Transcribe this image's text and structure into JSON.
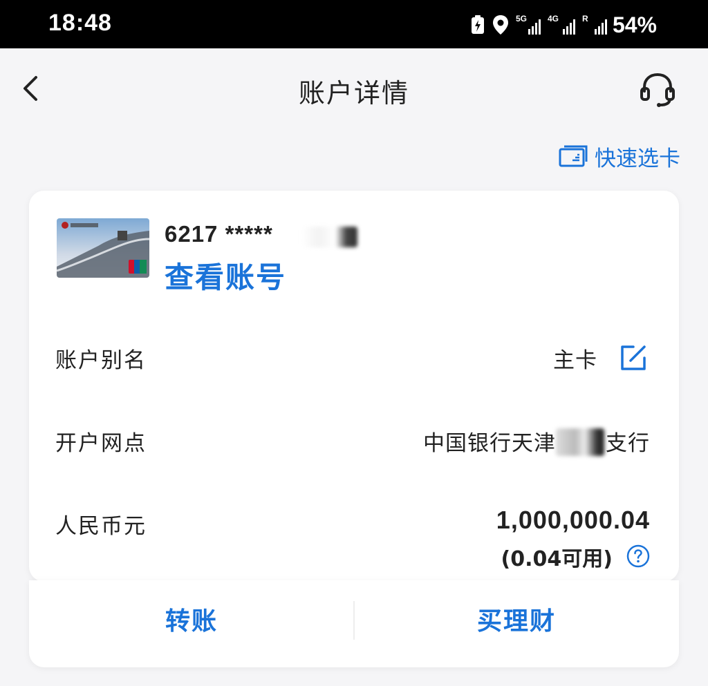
{
  "status_bar": {
    "time": "18:48",
    "network1": "5G",
    "network2": "4G",
    "roaming": "R",
    "battery_percent": "54%"
  },
  "header": {
    "title": "账户详情",
    "back_icon": "chevron-left-icon",
    "support_icon": "headset-icon"
  },
  "quick_select": {
    "label": "快速选卡",
    "icon": "card-stack-icon"
  },
  "card": {
    "number_masked": "6217 *****",
    "view_account_label": "查看账号",
    "thumbnail": "bank-card-image"
  },
  "details": {
    "alias_label": "账户别名",
    "alias_value": "主卡",
    "branch_label": "开户网点",
    "branch_value_prefix": "中国银行天津",
    "branch_value_suffix": "支行",
    "currency_label": "人民币元",
    "balance": "1,000,000.04",
    "available": "(0.04可用)"
  },
  "actions": {
    "transfer": "转账",
    "wealth": "买理财"
  },
  "colors": {
    "accent": "#1a73d9",
    "text": "#222222",
    "background": "#f5f5f7"
  }
}
